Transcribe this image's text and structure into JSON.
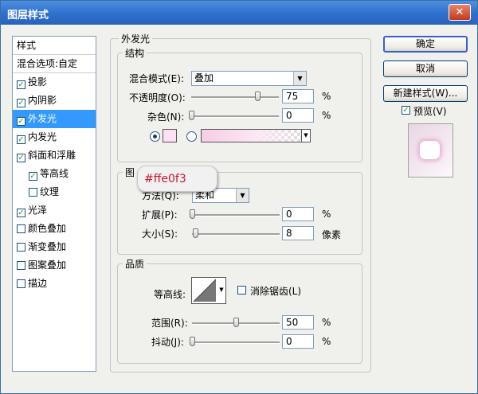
{
  "window": {
    "title": "图层样式",
    "close_label": "✕"
  },
  "sidebar": {
    "header": "样式",
    "blend_options": "混合选项:自定",
    "items": [
      {
        "label": "投影",
        "checked": true
      },
      {
        "label": "内阴影",
        "checked": true
      },
      {
        "label": "外发光",
        "checked": true,
        "selected": true
      },
      {
        "label": "内发光",
        "checked": true
      },
      {
        "label": "斜面和浮雕",
        "checked": true
      },
      {
        "label": "等高线",
        "checked": true,
        "sub": true
      },
      {
        "label": "纹理",
        "checked": false,
        "sub": true
      },
      {
        "label": "光泽",
        "checked": true
      },
      {
        "label": "颜色叠加",
        "checked": false
      },
      {
        "label": "渐变叠加",
        "checked": false
      },
      {
        "label": "图案叠加",
        "checked": false
      },
      {
        "label": "描边",
        "checked": false
      }
    ]
  },
  "outer_glow": {
    "section_title": "外发光",
    "structure": {
      "title": "结构",
      "blend_mode_label": "混合模式(E):",
      "blend_mode_value": "叠加",
      "opacity_label": "不透明度(O):",
      "opacity_value": "75",
      "opacity_unit": "%",
      "noise_label": "杂色(N):",
      "noise_value": "0",
      "noise_unit": "%",
      "glow_color": "#ffe0f3"
    },
    "elements": {
      "title": "图",
      "technique_label": "方法(Q):",
      "technique_value": "柔和",
      "spread_label": "扩展(P):",
      "spread_value": "0",
      "spread_unit": "%",
      "size_label": "大小(S):",
      "size_value": "8",
      "size_unit": "像素"
    },
    "quality": {
      "title": "品质",
      "contour_label": "等高线:",
      "antialias_label": "消除锯齿(L)",
      "antialias_checked": false,
      "range_label": "范围(R):",
      "range_value": "50",
      "range_unit": "%",
      "jitter_label": "抖动(J):",
      "jitter_value": "0",
      "jitter_unit": "%"
    }
  },
  "buttons": {
    "ok": "确定",
    "cancel": "取消",
    "new_style": "新建样式(W)..."
  },
  "preview": {
    "label": "预览(V)",
    "checked": true
  },
  "tooltip": {
    "text": "#ffe0f3"
  },
  "slider_levels": {
    "opacity": 0.75,
    "noise": 0,
    "spread": 0,
    "size": 0.04,
    "range": 0.5,
    "jitter": 0
  }
}
